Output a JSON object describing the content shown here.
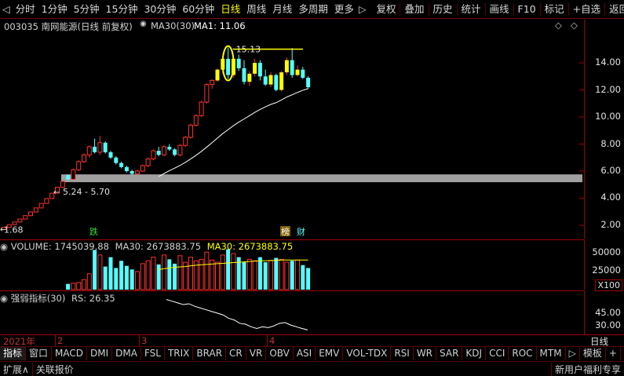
{
  "toolbar": {
    "left_arrow": "◁",
    "items": [
      {
        "label": "分时"
      },
      {
        "label": "1分钟"
      },
      {
        "label": "5分钟"
      },
      {
        "label": "15分钟"
      },
      {
        "label": "30分钟"
      },
      {
        "label": "60分钟"
      },
      {
        "label": "日线",
        "active": true
      },
      {
        "label": "周线"
      },
      {
        "label": "月线"
      },
      {
        "label": "多周期"
      },
      {
        "label": "更多"
      }
    ],
    "more_arrow": "▷",
    "right_items": [
      {
        "label": "复权"
      },
      {
        "label": "叠加"
      },
      {
        "label": "历史"
      },
      {
        "label": "统计"
      },
      {
        "label": "画线"
      },
      {
        "label": "F10"
      },
      {
        "label": "标记"
      },
      {
        "label": "+自选"
      },
      {
        "label": "返回"
      }
    ]
  },
  "stock": {
    "code_name": "003035 南网能源(日线 前复权)",
    "ma_label": "MA30(30)",
    "ma1": "MA1: 11.06"
  },
  "main_chart": {
    "y_ticks": [
      "14.00",
      "12.00",
      "10.00",
      "8.00",
      "6.00",
      "4.00",
      "2.00"
    ],
    "high_label": "15.13",
    "low_label": "1.68",
    "range_label": "5.24 - 5.70",
    "marker_die": "跌",
    "marker_bang": "榜",
    "marker_cai": "财"
  },
  "volume": {
    "label": "VOLUME: 1745039.88",
    "ma30_white": "MA30: 2673883.75",
    "ma30_yellow": "MA30: 2673883.75",
    "y_ticks": [
      "50000",
      "25000"
    ],
    "unit": "X100"
  },
  "rs": {
    "label": "强弱指标(30)",
    "value": "RS: 26.35",
    "y_ticks": [
      "45.00",
      "30.00"
    ]
  },
  "date_axis": {
    "year": "2021年",
    "months": [
      "2",
      "3",
      "4"
    ],
    "period": "日线"
  },
  "tabs": [
    "指标",
    "窗口",
    "MACD",
    "DMI",
    "DMA",
    "FSL",
    "TRIX",
    "BRAR",
    "CR",
    "VR",
    "OBV",
    "ASI",
    "EMV",
    "VOL-TDX",
    "RSI",
    "WR",
    "SAR",
    "KDJ",
    "CCI",
    "ROC",
    "MTM"
  ],
  "tabs_more": "▷",
  "tab_right": {
    "template": "模板",
    "plus": "+",
    "minus": "-"
  },
  "status": {
    "expand": "扩展∧",
    "related": "关联报价",
    "news": "新用户福利专享"
  },
  "colors": {
    "up": "#ff3232",
    "down": "#54ffff",
    "yellow": "#ffff00",
    "border": "#a00000",
    "ma": "#ffffff"
  },
  "chart_data": [
    {
      "type": "candlestick",
      "series": [
        {
          "name": "price",
          "ohlc": [
            [
              1.68,
              1.85,
              1.68,
              1.85
            ],
            [
              1.85,
              2.04,
              1.85,
              2.04
            ],
            [
              2.04,
              2.24,
              2.04,
              2.24
            ],
            [
              2.24,
              2.46,
              2.24,
              2.46
            ],
            [
              2.46,
              2.71,
              2.46,
              2.71
            ],
            [
              2.71,
              2.98,
              2.71,
              2.98
            ],
            [
              2.98,
              3.28,
              2.98,
              3.28
            ],
            [
              3.28,
              3.61,
              3.28,
              3.61
            ],
            [
              3.61,
              3.97,
              3.61,
              3.97
            ],
            [
              3.97,
              4.37,
              3.97,
              4.37
            ],
            [
              4.37,
              4.81,
              4.37,
              4.81
            ],
            [
              4.81,
              5.24,
              4.81,
              5.24
            ],
            [
              5.7,
              5.75,
              5.3,
              5.4
            ],
            [
              5.4,
              6.2,
              5.35,
              6.1
            ],
            [
              6.1,
              6.8,
              6.0,
              6.7
            ],
            [
              6.7,
              7.3,
              6.6,
              7.2
            ],
            [
              7.2,
              7.9,
              7.0,
              7.8
            ],
            [
              7.8,
              8.4,
              7.3,
              7.4
            ],
            [
              7.4,
              8.6,
              7.2,
              8.1
            ],
            [
              8.1,
              8.2,
              7.3,
              7.4
            ],
            [
              7.4,
              7.5,
              6.9,
              7.0
            ],
            [
              7.0,
              7.1,
              6.5,
              6.6
            ],
            [
              6.6,
              6.7,
              6.2,
              6.3
            ],
            [
              6.3,
              6.4,
              5.9,
              6.0
            ],
            [
              6.0,
              6.1,
              5.7,
              5.8
            ],
            [
              5.8,
              6.1,
              5.7,
              6.0
            ],
            [
              6.0,
              6.5,
              5.95,
              6.4
            ],
            [
              6.4,
              7.0,
              6.3,
              6.9
            ],
            [
              6.9,
              7.6,
              6.8,
              7.5
            ],
            [
              7.5,
              7.8,
              7.1,
              7.2
            ],
            [
              7.2,
              7.9,
              7.1,
              7.8
            ],
            [
              7.8,
              8.0,
              7.5,
              7.6
            ],
            [
              7.6,
              7.7,
              7.1,
              7.2
            ],
            [
              7.2,
              8.0,
              7.1,
              7.9
            ],
            [
              7.9,
              8.6,
              7.8,
              8.5
            ],
            [
              8.5,
              9.5,
              8.4,
              9.4
            ],
            [
              9.4,
              10.2,
              9.3,
              10.1
            ],
            [
              10.1,
              11.2,
              10.0,
              11.1
            ],
            [
              11.1,
              12.5,
              11.0,
              12.4
            ],
            [
              12.4,
              12.8,
              12.1,
              12.7
            ],
            [
              12.7,
              13.6,
              12.6,
              13.5
            ],
            [
              13.5,
              14.4,
              13.2,
              14.3
            ],
            [
              14.3,
              15.13,
              12.8,
              13.1
            ],
            [
              13.1,
              14.5,
              12.9,
              14.3
            ],
            [
              14.3,
              14.6,
              13.4,
              13.6
            ],
            [
              13.6,
              14.2,
              12.4,
              12.6
            ],
            [
              12.6,
              13.4,
              12.3,
              13.2
            ],
            [
              13.2,
              14.3,
              13.0,
              14.0
            ],
            [
              14.0,
              14.2,
              12.7,
              13.0
            ],
            [
              13.0,
              13.5,
              12.3,
              12.4
            ],
            [
              12.4,
              13.3,
              12.2,
              13.1
            ],
            [
              13.1,
              13.2,
              11.9,
              12.0
            ],
            [
              12.0,
              13.4,
              11.9,
              13.3
            ],
            [
              13.3,
              14.4,
              13.1,
              14.2
            ],
            [
              14.2,
              15.1,
              12.9,
              13.1
            ],
            [
              13.1,
              13.8,
              13.0,
              13.5
            ],
            [
              13.5,
              13.7,
              12.8,
              12.9
            ],
            [
              12.9,
              13.0,
              12.1,
              12.2
            ]
          ]
        },
        {
          "name": "MA30",
          "values": [
            null,
            null,
            null,
            null,
            null,
            null,
            null,
            null,
            null,
            null,
            null,
            null,
            null,
            null,
            null,
            null,
            null,
            null,
            null,
            null,
            null,
            null,
            null,
            null,
            null,
            null,
            null,
            null,
            null,
            5.6,
            5.82,
            6.03,
            6.22,
            6.42,
            6.65,
            6.9,
            7.17,
            7.46,
            7.78,
            8.1,
            8.44,
            8.78,
            9.06,
            9.36,
            9.62,
            9.85,
            10.09,
            10.34,
            10.56,
            10.75,
            10.93,
            11.06,
            11.26,
            11.48,
            11.64,
            11.82,
            11.97,
            12.1
          ]
        }
      ],
      "ylim": [
        1.3,
        16.5
      ],
      "range_band": [
        5.24,
        5.7
      ]
    },
    {
      "type": "bar",
      "name": "VOLUME",
      "values": [
        0,
        0,
        0,
        0,
        0,
        0,
        0,
        0,
        0,
        0,
        0,
        0,
        8000,
        9000,
        10000,
        14000,
        22000,
        55000,
        48000,
        32000,
        45000,
        30000,
        40000,
        33000,
        28000,
        25000,
        36000,
        40000,
        45000,
        35000,
        48000,
        42000,
        36000,
        47000,
        38000,
        45000,
        40000,
        42000,
        52000,
        41000,
        38000,
        48000,
        56000,
        50000,
        45000,
        38000,
        42000,
        40000,
        45000,
        38000,
        40000,
        44000,
        42000,
        38000,
        40000,
        41000,
        34000,
        30000
      ],
      "ma30_start": 29,
      "ma30_values": [
        28000,
        29000,
        30000,
        31000,
        31500,
        32000,
        33000,
        33800,
        34500,
        35000,
        35500,
        36000,
        36500,
        37000,
        37500,
        38000,
        38500,
        39000,
        39500,
        40000,
        40000,
        40500,
        40500,
        41000,
        41000,
        41000,
        41000,
        41000,
        41000
      ],
      "ylim": [
        0,
        62000
      ]
    },
    {
      "type": "line",
      "name": "RS",
      "x_start": 38,
      "values": [
        62,
        60,
        58,
        56,
        57,
        54,
        52,
        50,
        48,
        46,
        44,
        40,
        38,
        34,
        33,
        30,
        28,
        30,
        29,
        31,
        34,
        35,
        32,
        30,
        28,
        26.35
      ],
      "ylim": [
        22,
        68
      ]
    }
  ]
}
